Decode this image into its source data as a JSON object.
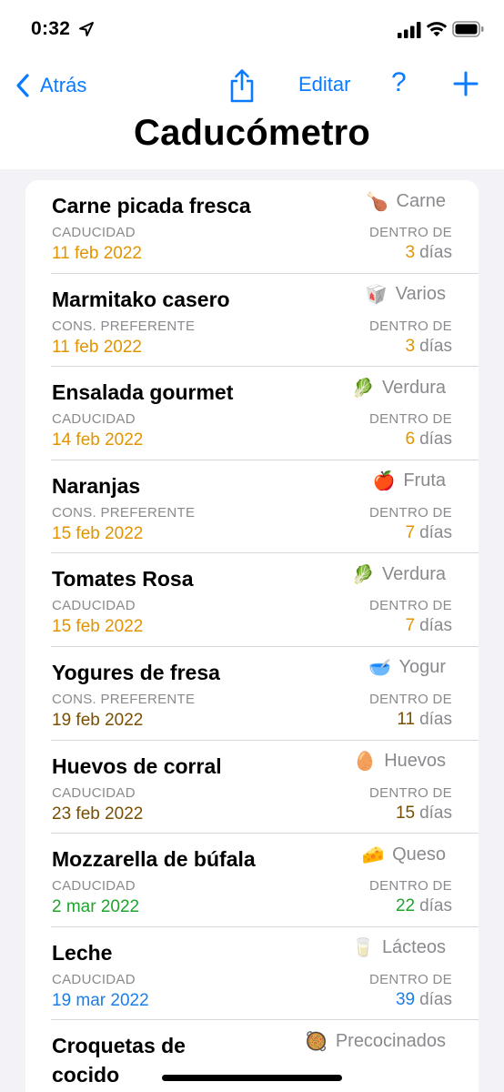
{
  "status": {
    "time": "0:32"
  },
  "nav": {
    "back_label": "Atrás",
    "edit_label": "Editar",
    "help_label": "?"
  },
  "title": "Caducómetro",
  "colors": {
    "accent": "#0a7aff",
    "orange": "#e29400",
    "brown": "#7a4f00",
    "green": "#1fa52b",
    "blue": "#1a7ee8",
    "secondary": "#8a8a8e"
  },
  "items": [
    {
      "name": "Carne picada fresca",
      "emoji": "🍗",
      "category": "Carne",
      "date_label": "CADUCIDAD",
      "date": "11 feb 2022",
      "within_label": "DENTRO DE",
      "days": "3",
      "days_unit": "días",
      "color": "#e29400"
    },
    {
      "name": "Marmitako casero",
      "emoji": "🥡",
      "category": "Varios",
      "date_label": "CONS. PREFERENTE",
      "date": "11 feb 2022",
      "within_label": "DENTRO DE",
      "days": "3",
      "days_unit": "días",
      "color": "#e29400"
    },
    {
      "name": "Ensalada gourmet",
      "emoji": "🥬",
      "category": "Verdura",
      "date_label": "CADUCIDAD",
      "date": "14 feb 2022",
      "within_label": "DENTRO DE",
      "days": "6",
      "days_unit": "días",
      "color": "#e29400"
    },
    {
      "name": "Naranjas",
      "emoji": "🍎",
      "category": "Fruta",
      "date_label": "CONS. PREFERENTE",
      "date": "15 feb 2022",
      "within_label": "DENTRO DE",
      "days": "7",
      "days_unit": "días",
      "color": "#e29400"
    },
    {
      "name": "Tomates Rosa",
      "emoji": "🥬",
      "category": "Verdura",
      "date_label": "CADUCIDAD",
      "date": "15 feb 2022",
      "within_label": "DENTRO DE",
      "days": "7",
      "days_unit": "días",
      "color": "#e29400"
    },
    {
      "name": "Yogures de fresa",
      "emoji": "🥣",
      "category": "Yogur",
      "date_label": "CONS. PREFERENTE",
      "date": "19 feb 2022",
      "within_label": "DENTRO DE",
      "days": "11",
      "days_unit": "días",
      "color": "#7a4f00"
    },
    {
      "name": "Huevos de corral",
      "emoji": "🥚",
      "category": "Huevos",
      "date_label": "CADUCIDAD",
      "date": "23 feb 2022",
      "within_label": "DENTRO DE",
      "days": "15",
      "days_unit": "días",
      "color": "#7a4f00"
    },
    {
      "name": "Mozzarella de búfala",
      "emoji": "🧀",
      "category": "Queso",
      "date_label": "CADUCIDAD",
      "date": "2 mar 2022",
      "within_label": "DENTRO DE",
      "days": "22",
      "days_unit": "días",
      "color": "#1fa52b"
    },
    {
      "name": "Leche",
      "emoji": "🥛",
      "category": "Lácteos",
      "date_label": "CADUCIDAD",
      "date": "19 mar 2022",
      "within_label": "DENTRO DE",
      "days": "39",
      "days_unit": "días",
      "color": "#1a7ee8"
    },
    {
      "name": "Croquetas de cocido",
      "emoji": "🥘",
      "category": "Precocinados"
    }
  ]
}
